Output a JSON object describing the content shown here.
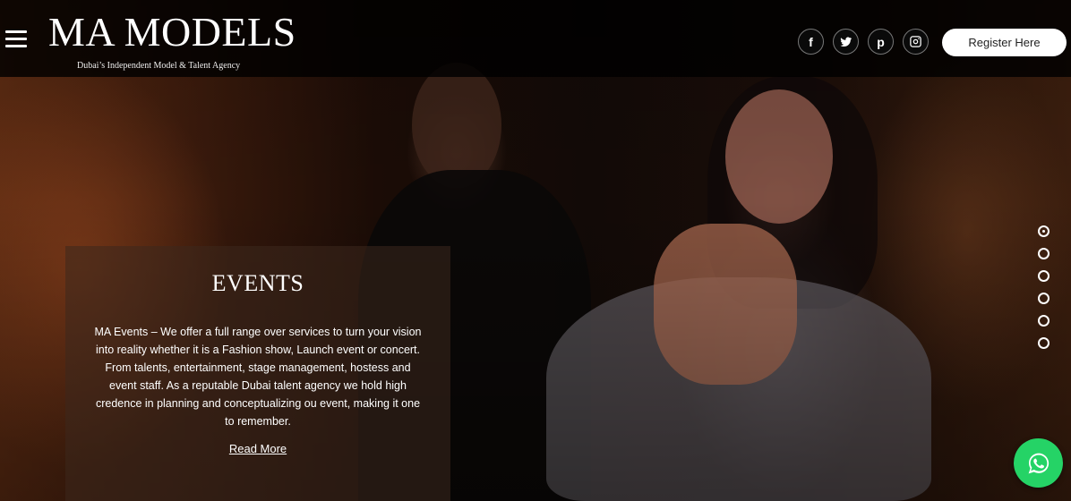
{
  "brand": {
    "title": "MA MODELS",
    "tagline": "Dubai’s Independent Model & Talent Agency"
  },
  "header": {
    "register_label": "Register Here",
    "social": [
      {
        "icon": "facebook-icon",
        "glyph": "f"
      },
      {
        "icon": "twitter-icon"
      },
      {
        "icon": "pinterest-icon",
        "glyph": "p"
      },
      {
        "icon": "instagram-icon"
      }
    ]
  },
  "panel": {
    "title": "EVENTS",
    "text": "MA Events – We offer a full range over services to turn your vision into reality whether it is a Fashion show, Launch event or concert. From talents, entertainment, stage management, hostess and event staff.  As a reputable Dubai talent agency we hold high credence in planning and conceptualizing ou event, making it one to remember.",
    "read_more": "Read More"
  },
  "slider": {
    "count": 6,
    "active": 1
  },
  "colors": {
    "whatsapp": "#25d366",
    "register_bg": "#ffffff"
  }
}
